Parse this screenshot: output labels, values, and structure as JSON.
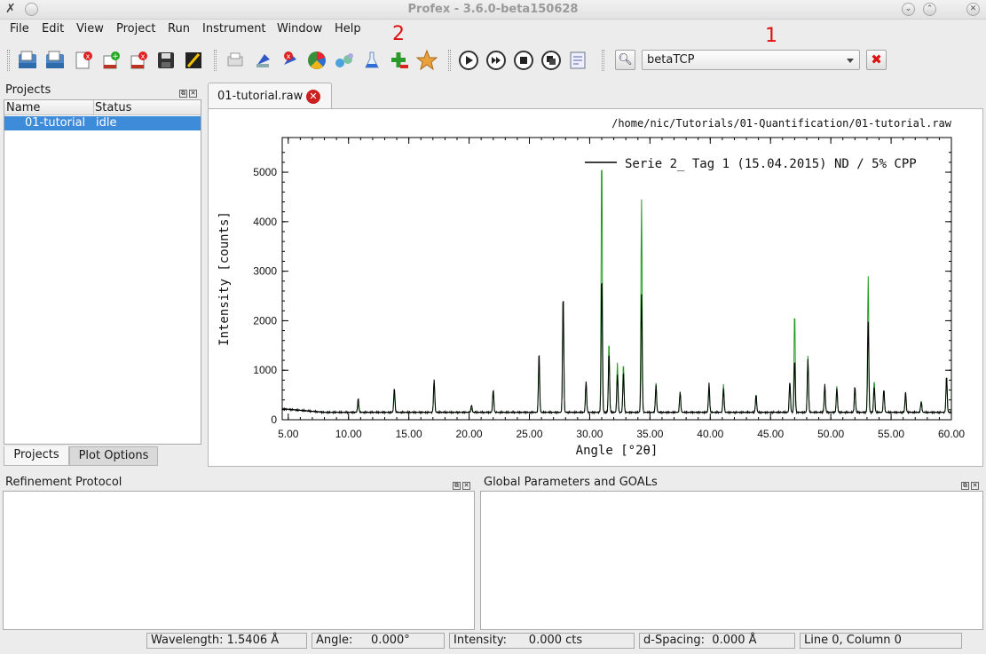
{
  "window": {
    "title": "Profex - 3.6.0-beta150628"
  },
  "menu": [
    "File",
    "Edit",
    "View",
    "Project",
    "Run",
    "Instrument",
    "Window",
    "Help"
  ],
  "annotations": {
    "one": "1",
    "two": "2"
  },
  "toolbar": {
    "phase_combo_value": "betaTCP"
  },
  "projects_panel": {
    "title": "Projects",
    "columns": [
      "Name",
      "Status"
    ],
    "rows": [
      {
        "name": "01-tutorial",
        "status": "idle"
      }
    ],
    "tabs": [
      "Projects",
      "Plot Options"
    ]
  },
  "doc_tab": {
    "label": "01-tutorial.raw"
  },
  "plot": {
    "file_path": "/home/nic/Tutorials/01-Quantification/01-tutorial.raw"
  },
  "chart_data": {
    "type": "line",
    "xlabel": "Angle [°2θ]",
    "ylabel": "Intensity [counts]",
    "xlim": [
      4.5,
      60.0
    ],
    "ylim": [
      0,
      5700
    ],
    "xticks": [
      "5.00",
      "10.00",
      "15.00",
      "20.00",
      "25.00",
      "30.00",
      "35.00",
      "40.00",
      "45.00",
      "50.00",
      "55.00",
      "60.00"
    ],
    "xtick_values": [
      5,
      10,
      15,
      20,
      25,
      30,
      35,
      40,
      45,
      50,
      55,
      60
    ],
    "yticks": [
      "0",
      "1000",
      "2000",
      "3000",
      "4000",
      "5000"
    ],
    "ytick_values": [
      0,
      1000,
      2000,
      3000,
      4000,
      5000
    ],
    "legend": {
      "entry": "Serie 2_ Tag 1 (15.04.2015) ND / 5% CPP",
      "position": "top-right"
    },
    "colors": {
      "measured": "#000000",
      "calculated": "#1f9a1f"
    },
    "background_level": 150,
    "peaks": [
      {
        "x": 10.8,
        "measured": 430,
        "calculated": 330
      },
      {
        "x": 13.8,
        "measured": 650,
        "calculated": 530
      },
      {
        "x": 17.1,
        "measured": 820,
        "calculated": 760
      },
      {
        "x": 20.2,
        "measured": 300,
        "calculated": 230
      },
      {
        "x": 22.0,
        "measured": 620,
        "calculated": 560
      },
      {
        "x": 25.8,
        "measured": 1380,
        "calculated": 1200
      },
      {
        "x": 27.8,
        "measured": 2570,
        "calculated": 2570
      },
      {
        "x": 29.7,
        "measured": 780,
        "calculated": 760
      },
      {
        "x": 31.0,
        "measured": 2960,
        "calculated": 5450
      },
      {
        "x": 31.6,
        "measured": 1380,
        "calculated": 1600
      },
      {
        "x": 32.3,
        "measured": 920,
        "calculated": 1150
      },
      {
        "x": 32.8,
        "measured": 980,
        "calculated": 1150
      },
      {
        "x": 34.3,
        "measured": 2550,
        "calculated": 4450
      },
      {
        "x": 35.5,
        "measured": 700,
        "calculated": 740
      },
      {
        "x": 37.5,
        "measured": 560,
        "calculated": 570
      },
      {
        "x": 39.9,
        "measured": 740,
        "calculated": 620
      },
      {
        "x": 41.1,
        "measured": 620,
        "calculated": 720
      },
      {
        "x": 43.8,
        "measured": 500,
        "calculated": 520
      },
      {
        "x": 46.6,
        "measured": 790,
        "calculated": 720
      },
      {
        "x": 47.0,
        "measured": 1220,
        "calculated": 2200
      },
      {
        "x": 48.1,
        "measured": 1220,
        "calculated": 1290
      },
      {
        "x": 49.5,
        "measured": 720,
        "calculated": 680
      },
      {
        "x": 50.5,
        "measured": 640,
        "calculated": 680
      },
      {
        "x": 52.0,
        "measured": 680,
        "calculated": 640
      },
      {
        "x": 53.1,
        "measured": 1980,
        "calculated": 2900
      },
      {
        "x": 53.6,
        "measured": 680,
        "calculated": 800
      },
      {
        "x": 54.4,
        "measured": 620,
        "calculated": 620
      },
      {
        "x": 56.2,
        "measured": 580,
        "calculated": 470
      },
      {
        "x": 57.5,
        "measured": 360,
        "calculated": 380
      },
      {
        "x": 59.6,
        "measured": 900,
        "calculated": 900
      }
    ]
  },
  "refinement_panel": {
    "title": "Refinement Protocol"
  },
  "global_panel": {
    "title": "Global Parameters and GOALs"
  },
  "statusbar": {
    "wavelength": "Wavelength: 1.5406 Å",
    "angle": "Angle:     0.000°",
    "intensity": "Intensity:      0.000 cts",
    "dspacing": "d-Spacing:  0.000 Å",
    "cursor": "Line 0, Column 0"
  }
}
